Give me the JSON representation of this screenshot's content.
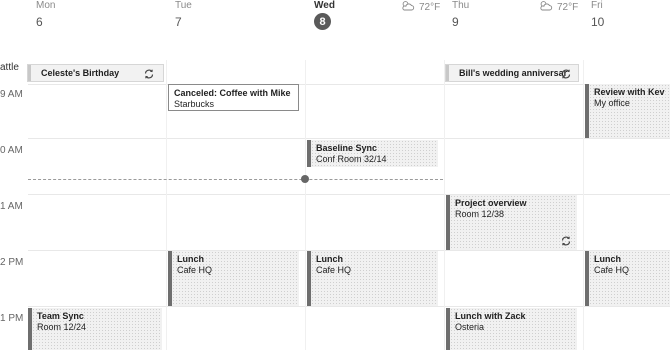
{
  "days": [
    {
      "name": "Mon",
      "num": "6"
    },
    {
      "name": "Tue",
      "num": "7"
    },
    {
      "name": "Wed",
      "num": "8"
    },
    {
      "name": "Thu",
      "num": "9"
    },
    {
      "name": "Fri",
      "num": "10"
    }
  ],
  "weather": [
    {
      "temp": "72°F",
      "icon": "partly-cloudy-icon"
    },
    {
      "temp": "72°F",
      "icon": "partly-cloudy-icon"
    }
  ],
  "time_labels": [
    "9 AM",
    "0 AM",
    "1 AM",
    "2 PM",
    "1 PM"
  ],
  "allday_label": "attle",
  "allday_events": [
    {
      "title": "Celeste's Birthday",
      "recurring": true
    },
    {
      "title": "Bill's wedding anniversar",
      "recurring": true
    }
  ],
  "events": [
    {
      "title": "Canceled: Coffee with Mike",
      "location": "Starbucks",
      "canceled": true
    },
    {
      "title": "Review with Kevin",
      "location": "My office"
    },
    {
      "title": "Baseline Sync",
      "location": "Conf Room 32/14"
    },
    {
      "title": "Project overview",
      "location": "Room 12/38",
      "recurring": true
    },
    {
      "title": "Lunch",
      "location": "Cafe HQ"
    },
    {
      "title": "Lunch",
      "location": "Cafe HQ"
    },
    {
      "title": "Lunch",
      "location": "Cafe HQ"
    },
    {
      "title": "Team Sync",
      "location": "Room 12/24"
    },
    {
      "title": "Lunch with Zack",
      "location": "Osteria"
    }
  ]
}
